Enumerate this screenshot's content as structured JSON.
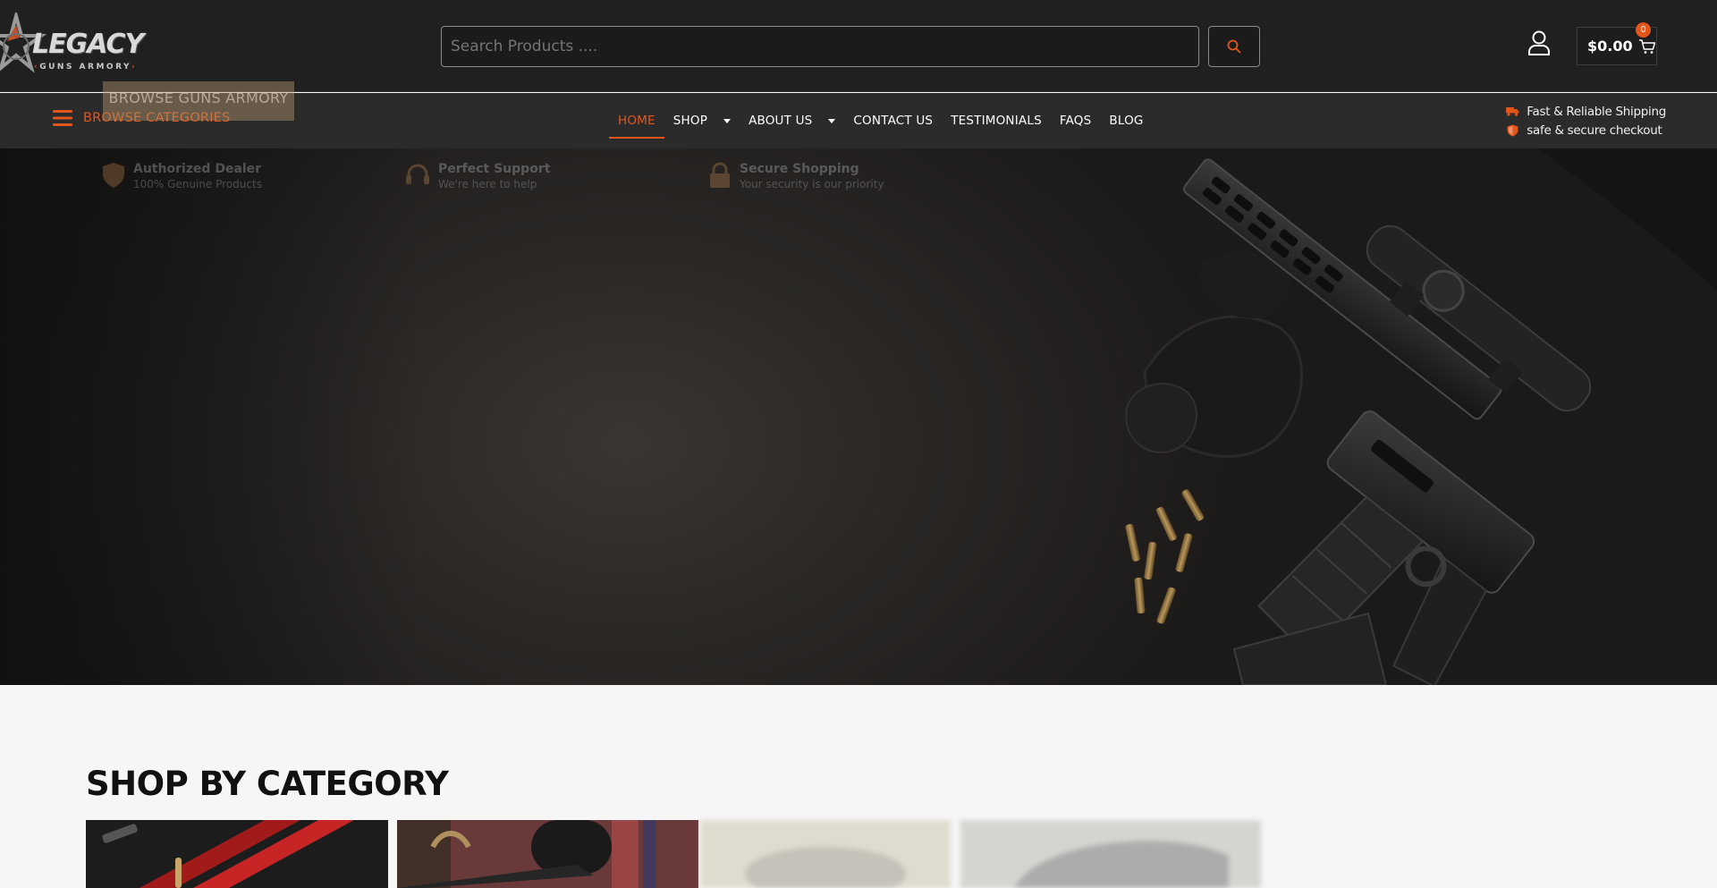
{
  "header": {
    "logo": {
      "word": "LEGACY",
      "sub": "GUNS ARMORY"
    },
    "search": {
      "placeholder": "Search Products ...."
    },
    "cart": {
      "total": "$0.00",
      "count": "0"
    },
    "colors": {
      "accent": "#e2561b",
      "bg": "#202020"
    }
  },
  "nav": {
    "browse_label": "BROWSE CATEGORIES",
    "browse_overlay": "BROWSE GUNS ARMORY",
    "menu": [
      {
        "label": "HOME",
        "active": true
      },
      {
        "label": "SHOP",
        "dropdown": true
      },
      {
        "label": "ABOUT US",
        "dropdown": true
      },
      {
        "label": "CONTACT US"
      },
      {
        "label": "TESTIMONIALS"
      },
      {
        "label": "FAQS"
      },
      {
        "label": "BLOG"
      }
    ],
    "perks": [
      {
        "icon": "truck-icon",
        "text": "Fast & Reliable Shipping"
      },
      {
        "icon": "shield-icon",
        "text": "safe & secure checkout"
      }
    ]
  },
  "hero": {
    "features": [
      {
        "icon": "shield-icon",
        "title": "Authorized Dealer",
        "subtitle": "100% Genuine Products"
      },
      {
        "icon": "headset-icon",
        "title": "Perfect Support",
        "subtitle": "We're here to help"
      },
      {
        "icon": "lock-icon",
        "title": "Secure Shopping",
        "subtitle": "Your security is our priority"
      }
    ]
  },
  "categories": {
    "title": "SHOP BY CATEGORY"
  }
}
